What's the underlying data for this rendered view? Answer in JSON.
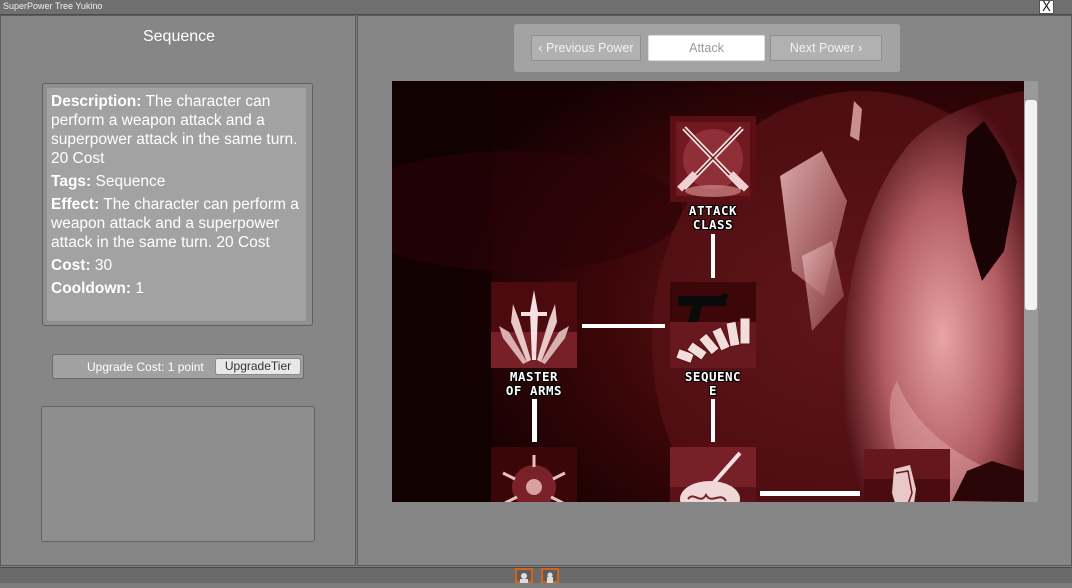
{
  "window": {
    "title": "SuperPower Tree Yukino",
    "close_label": "X"
  },
  "left": {
    "title": "Sequence",
    "description_label": "Description:",
    "description": "The character can perform a weapon attack and a superpower attack in the same turn. 20 Cost",
    "tags_label": "Tags:",
    "tags": "Sequence",
    "effect_label": "Effect:",
    "effect": "The character can perform a weapon attack and a superpower attack in the same turn. 20 Cost",
    "cost_label": "Cost:",
    "cost": "30",
    "cooldown_label": "Cooldown:",
    "cooldown": "1",
    "upgrade_cost": "Upgrade Cost: 1 point",
    "upgrade_button": "UpgradeTier"
  },
  "nav": {
    "prev_label": "‹  Previous Power",
    "current": "Attack",
    "next_label": "Next Power  ›"
  },
  "tree": {
    "nodes": [
      {
        "id": "attack-class",
        "label_line1": "Attack",
        "label_line2": "Class",
        "icon": "crossed-swords-icon"
      },
      {
        "id": "master-of-arms",
        "label_line1": "Master",
        "label_line2": "of Arms",
        "icon": "weapons-fan-icon"
      },
      {
        "id": "sequence",
        "label_line1": "Sequenc",
        "label_line2": "e",
        "icon": "gun-dominoes-icon"
      },
      {
        "id": "unknown-bottom-left",
        "icon": "spiked-orb-icon"
      },
      {
        "id": "unknown-bottom-mid",
        "icon": "brain-sword-icon"
      },
      {
        "id": "unknown-bottom-right",
        "icon": "praying-hands-icon"
      }
    ]
  },
  "colors": {
    "panel_bg": "#868686",
    "tree_bg": "#1a0203",
    "accent": "#d4641e"
  }
}
